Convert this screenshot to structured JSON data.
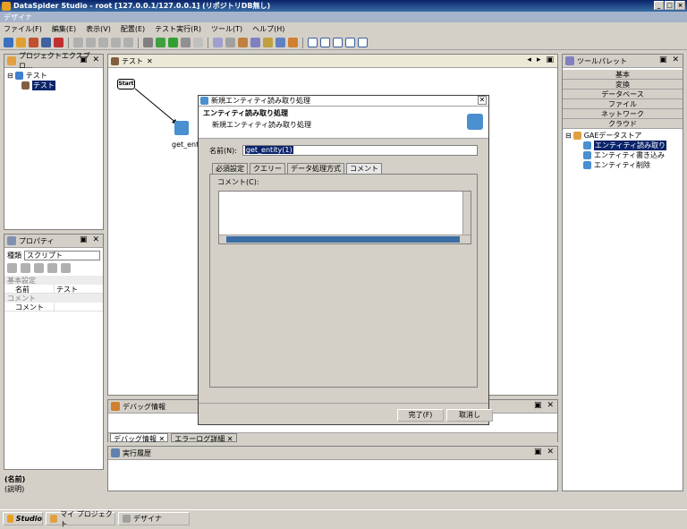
{
  "window": {
    "title": "DataSpider Studio - root [127.0.0.1/127.0.0.1] (リポジトリDB無し)"
  },
  "perspective": {
    "label": "デザイナ"
  },
  "menu": [
    "ファイル(F)",
    "編集(E)",
    "表示(V)",
    "配置(E)",
    "テスト実行(R)",
    "ツール(T)",
    "ヘルプ(H)"
  ],
  "project_explorer": {
    "title": "プロジェクトエクスプロ...",
    "root": "テスト",
    "child": "テスト"
  },
  "properties": {
    "title": "プロパティ",
    "type_label": "種類",
    "type_value": "スクリプト",
    "section_basic": "基本設定",
    "name_key": "名前",
    "name_value": "テスト",
    "section_comment": "コメント",
    "comment_key": "コメント",
    "footer_name": "(名前)",
    "footer_desc": "(説明)"
  },
  "editor": {
    "tab": "テスト",
    "start_label": "Start",
    "node_label": "get_entity"
  },
  "tool_palette": {
    "title": "ツールパレット",
    "categories": [
      "基本",
      "変換",
      "データベース",
      "ファイル",
      "ネットワーク",
      "クラウド"
    ],
    "group": "GAEデータストア",
    "items": [
      "エンティティ読み取り",
      "エンティティ書き込み",
      "エンティティ削除"
    ]
  },
  "debug_panel": {
    "title": "デバッグ情報",
    "tabs": [
      "デバッグ情報",
      "エラーログ詳細"
    ]
  },
  "history_panel": {
    "title": "実行履歴"
  },
  "dialog": {
    "title": "新規エンティティ読み取り処理",
    "heading": "エンティティ読み取り処理",
    "subheading": "新規エンティティ読み取り処理",
    "name_label": "名前(N):",
    "name_value": "get_entity(1)",
    "tabs": [
      "必須設定",
      "クエリー",
      "データ処理方式",
      "コメント"
    ],
    "comment_label": "コメント(C):",
    "ok_label": "完了(F)",
    "cancel_label": "取消し"
  },
  "taskbar": {
    "studio": "Studio",
    "my_project": "マイ プロジェクト",
    "designer": "デザイナ"
  },
  "colors": {
    "accent": "#0a246a",
    "window_bg": "#d4d0c8"
  }
}
